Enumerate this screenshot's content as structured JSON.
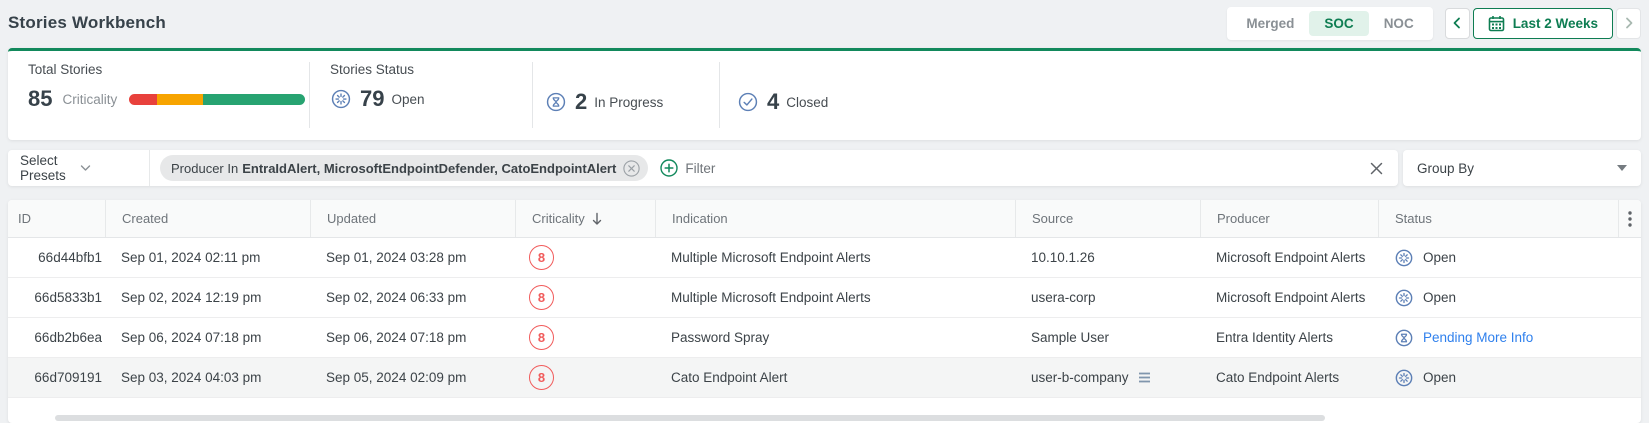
{
  "header": {
    "title": "Stories Workbench",
    "views": [
      "Merged",
      "SOC",
      "NOC"
    ],
    "selected_view": "SOC",
    "date_range_label": "Last 2 Weeks"
  },
  "stats": {
    "total_label": "Total Stories",
    "total_value": "85",
    "criticality_label": "Criticality",
    "criticality_bar": {
      "segments": [
        {
          "name": "criticality-high-segment",
          "color": "#e8413c",
          "percent": 16
        },
        {
          "name": "criticality-medium-segment",
          "color": "#f7a400",
          "percent": 26
        },
        {
          "name": "criticality-low-segment",
          "color": "#27a371",
          "percent": 58
        }
      ]
    },
    "status_label": "Stories Status",
    "open": {
      "value": "79",
      "label": "Open"
    },
    "in_progress": {
      "value": "2",
      "label": "In Progress"
    },
    "closed": {
      "value": "4",
      "label": "Closed"
    }
  },
  "filter": {
    "presets_label": "Select Presets",
    "chip_prefix": "Producer In",
    "chip_values": "EntraIdAlert, MicrosoftEndpointDefender, CatoEndpointAlert",
    "add_label": "Filter",
    "group_by_label": "Group By"
  },
  "table": {
    "columns": [
      "ID",
      "Created",
      "Updated",
      "Criticality",
      "Indication",
      "Source",
      "Producer",
      "Status"
    ],
    "rows": [
      {
        "id": "66d44bfb1",
        "created": "Sep 01, 2024 02:11 pm",
        "updated": "Sep 01, 2024 03:28 pm",
        "criticality": "8",
        "indication": "Multiple Microsoft Endpoint Alerts",
        "source": "10.10.1.26",
        "producer": "Microsoft Endpoint Alerts",
        "status": "Open",
        "status_type": "open",
        "source_list_icon": false,
        "highlighted": false
      },
      {
        "id": "66d5833b1",
        "created": "Sep 02, 2024 12:19 pm",
        "updated": "Sep 02, 2024 06:33 pm",
        "criticality": "8",
        "indication": "Multiple Microsoft Endpoint Alerts",
        "source": "usera-corp",
        "producer": "Microsoft Endpoint Alerts",
        "status": "Open",
        "status_type": "open",
        "source_list_icon": false,
        "highlighted": false
      },
      {
        "id": "66db2b6ea",
        "created": "Sep 06, 2024 07:18 pm",
        "updated": "Sep 06, 2024 07:18 pm",
        "criticality": "8",
        "indication": "Password Spray",
        "source": "Sample User",
        "producer": "Entra Identity Alerts",
        "status": "Pending More Info",
        "status_type": "pending",
        "source_list_icon": false,
        "highlighted": false
      },
      {
        "id": "66d709191",
        "created": "Sep 03, 2024 04:03 pm",
        "updated": "Sep 05, 2024 02:09 pm",
        "criticality": "8",
        "indication": "Cato Endpoint Alert",
        "source": "user-b-company",
        "producer": "Cato Endpoint Alerts",
        "status": "Open",
        "status_type": "open",
        "source_list_icon": true,
        "highlighted": true
      }
    ]
  },
  "colors": {
    "accent_green": "#0e7d52",
    "criticality_red": "#f15b5b",
    "status_icon_blue": "#5d80b6",
    "link_blue": "#2f80ed"
  }
}
